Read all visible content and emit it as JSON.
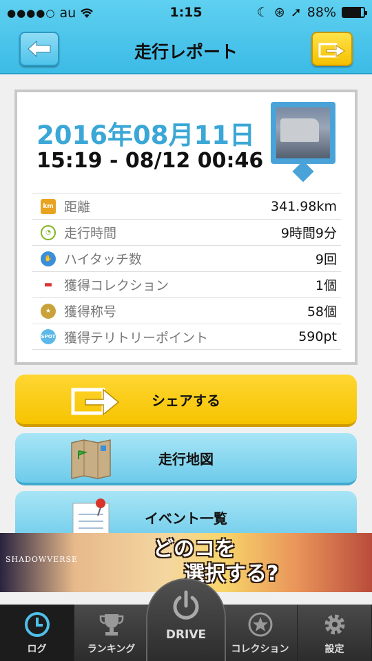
{
  "status_bar": {
    "carrier": "au",
    "time": "1:15",
    "battery": "88%",
    "battery_level": 0.88
  },
  "header": {
    "title": "走行レポート"
  },
  "report": {
    "date": "2016年08月11日",
    "time_range": "15:19 - 08/12 00:46",
    "stats": [
      {
        "icon": "km-icon",
        "label": "距離",
        "value": "341.98km"
      },
      {
        "icon": "clock-icon",
        "label": "走行時間",
        "value": "9時間9分"
      },
      {
        "icon": "hand-icon",
        "label": "ハイタッチ数",
        "value": "9回"
      },
      {
        "icon": "car-icon",
        "label": "獲得コレクション",
        "value": "1個"
      },
      {
        "icon": "medal-icon",
        "label": "獲得称号",
        "value": "58個"
      },
      {
        "icon": "spot-icon",
        "label": "獲得テリトリーポイント",
        "value": "590pt"
      }
    ]
  },
  "actions": {
    "share": "シェアする",
    "map": "走行地図",
    "events": "イベント一覧"
  },
  "ad": {
    "logo": "SHADOWVERSE",
    "line1": "どのコを",
    "line2": "選択する?"
  },
  "tabs": {
    "log": "ログ",
    "ranking": "ランキング",
    "drive": "DRIVE",
    "collection": "コレクション",
    "settings": "設定"
  },
  "colors": {
    "header": "#3cbbe6",
    "accent_blue": "#3aa7d6",
    "share_yellow": "#f6c400"
  }
}
